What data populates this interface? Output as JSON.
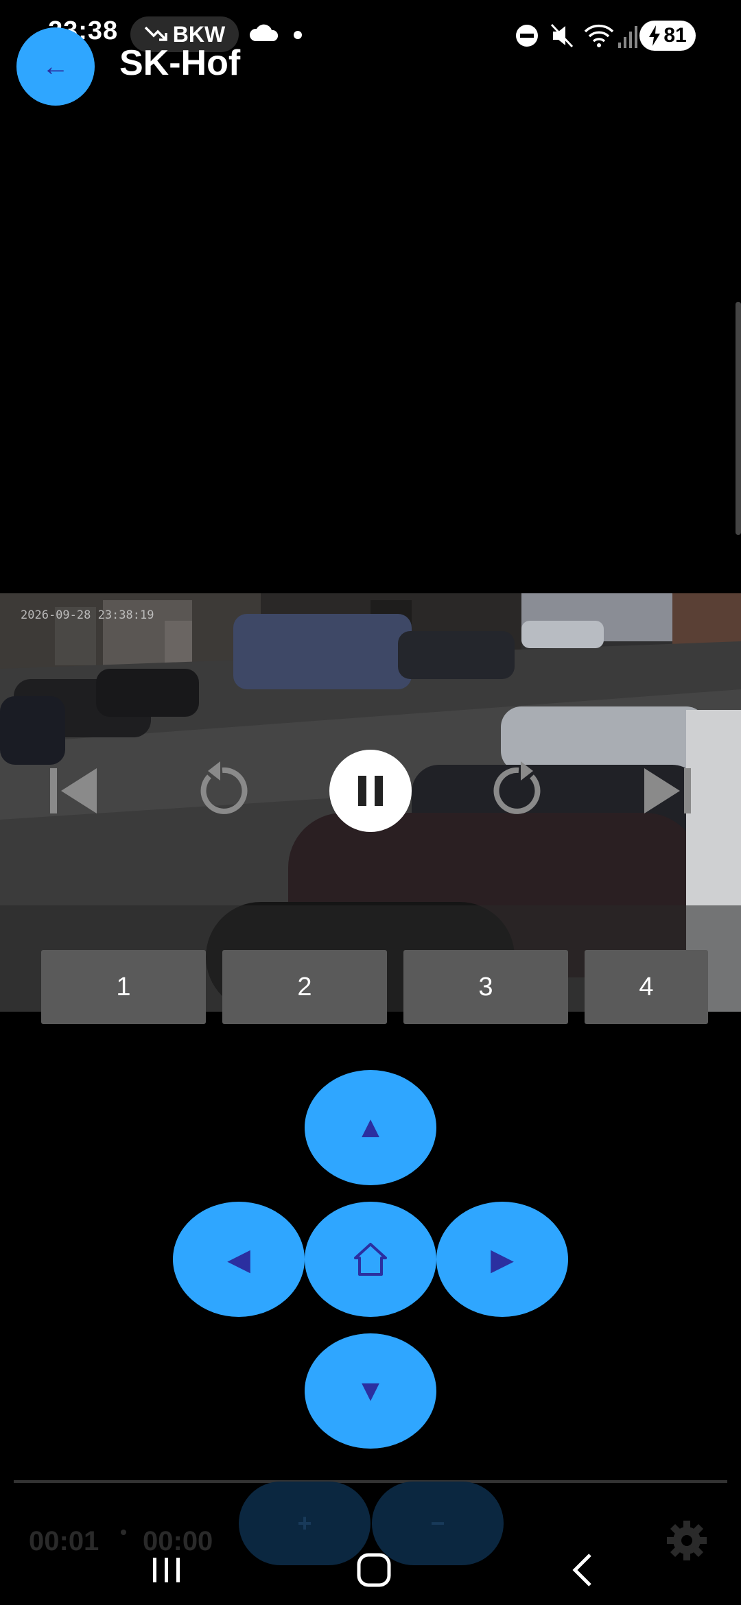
{
  "status_bar": {
    "time": "23:38",
    "pill_label": "BKW",
    "battery_level": "81"
  },
  "header": {
    "back_icon": "←",
    "title": "SK-Hof"
  },
  "video": {
    "camera_timestamp": "2026-09-28 23:38:19",
    "controls": [
      "skip-previous",
      "replay",
      "pause",
      "forward",
      "skip-next"
    ]
  },
  "presets": [
    "1",
    "2",
    "3",
    "4"
  ],
  "dpad": {
    "up_icon": "▲",
    "down_icon": "▼",
    "left_icon": "◀",
    "right_icon": "▶",
    "home_icon": "house-outline"
  },
  "playback": {
    "current_time": "00:01",
    "duration": "00:00"
  },
  "zoom": {
    "zoom_in_label": "+",
    "zoom_out_label": "−"
  },
  "colors": {
    "accent": "#2fa6ff",
    "icon_on_accent": "#2b2fa0",
    "preset_bg": "#5a5a5a"
  }
}
